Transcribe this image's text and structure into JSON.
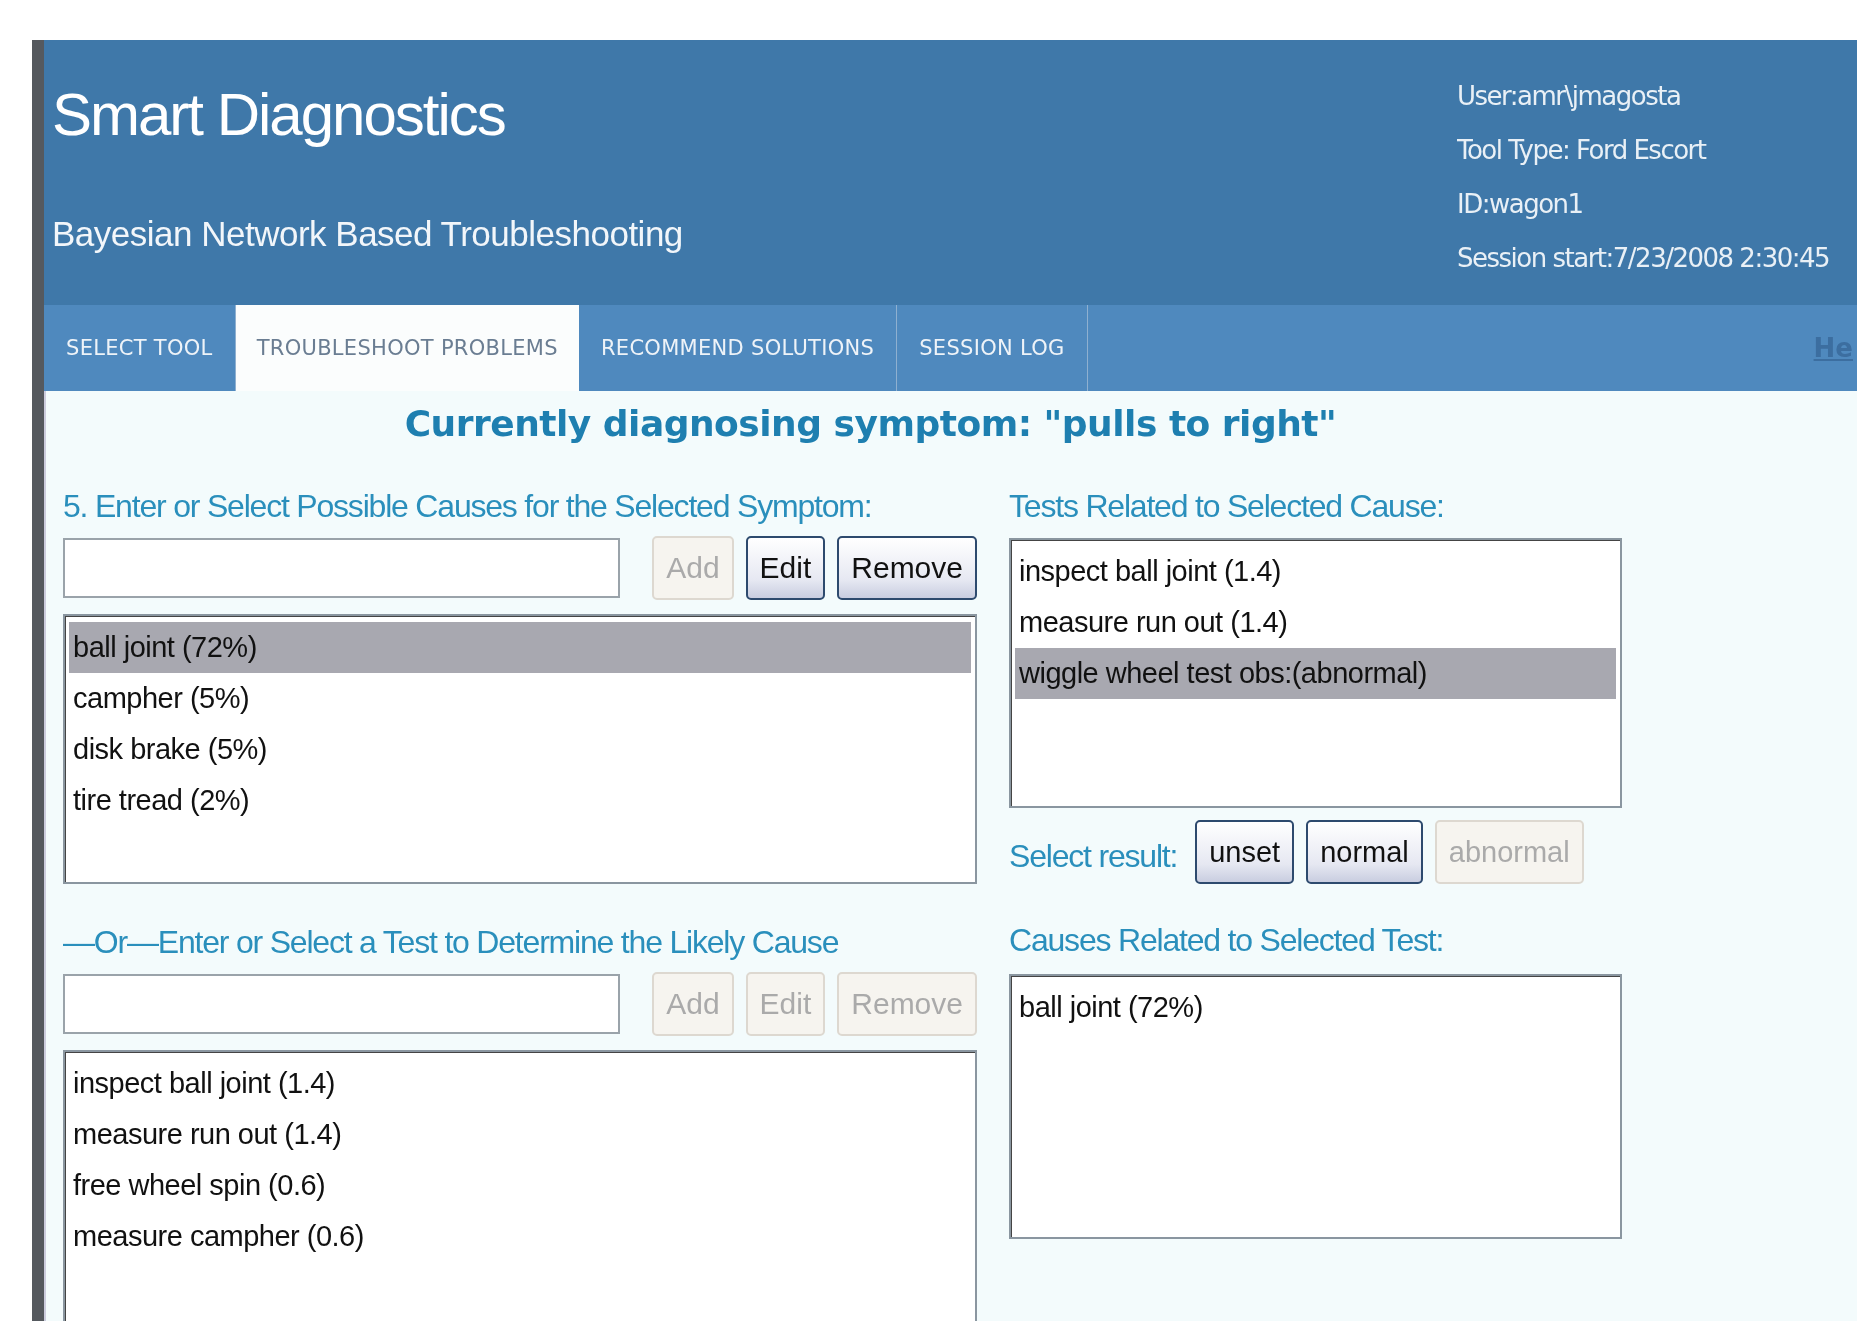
{
  "header": {
    "title": "Smart Diagnostics",
    "subtitle": "Bayesian Network Based Troubleshooting",
    "session_info": [
      "User:amr\\jmagosta",
      "Tool Type: Ford Escort",
      "ID:wagon1",
      "Session start:7/23/2008 2:30:45"
    ]
  },
  "tabs": [
    {
      "label": "SELECT TOOL",
      "selected": false
    },
    {
      "label": "TROUBLESHOOT PROBLEMS",
      "selected": true
    },
    {
      "label": "RECOMMEND SOLUTIONS",
      "selected": false
    },
    {
      "label": "SESSION LOG",
      "selected": false
    }
  ],
  "help_link": "He",
  "heading": "Currently diagnosing symptom: \"pulls to right\"",
  "causes_panel": {
    "label": "5. Enter or Select Possible Causes for the Selected Symptom:",
    "buttons": [
      {
        "label": "Add",
        "disabled": true
      },
      {
        "label": "Edit",
        "disabled": false
      },
      {
        "label": "Remove",
        "disabled": false
      }
    ],
    "items": [
      {
        "label": "ball joint (72%)",
        "selected": true
      },
      {
        "label": "campher (5%)",
        "selected": false
      },
      {
        "label": "disk brake (5%)",
        "selected": false
      },
      {
        "label": "tire tread (2%)",
        "selected": false
      }
    ]
  },
  "tests_panel": {
    "label": "—Or—Enter or Select a Test to Determine the Likely Cause",
    "buttons": [
      {
        "label": "Add",
        "disabled": true
      },
      {
        "label": "Edit",
        "disabled": true
      },
      {
        "label": "Remove",
        "disabled": true
      }
    ],
    "items": [
      {
        "label": "inspect ball joint (1.4)",
        "selected": false
      },
      {
        "label": "measure run out (1.4)",
        "selected": false
      },
      {
        "label": "free wheel spin (0.6)",
        "selected": false
      },
      {
        "label": "measure campher (0.6)",
        "selected": false
      }
    ]
  },
  "related_tests": {
    "label": "Tests Related to Selected Cause:",
    "items": [
      {
        "label": "inspect ball joint (1.4)",
        "selected": false
      },
      {
        "label": "measure run out (1.4)",
        "selected": false
      },
      {
        "label": "wiggle wheel test obs:(abnormal)",
        "selected": true
      }
    ]
  },
  "result_selector": {
    "label": "Select result:",
    "buttons": [
      {
        "label": "unset",
        "disabled": false
      },
      {
        "label": "normal",
        "disabled": false
      },
      {
        "label": "abnormal",
        "disabled": true
      }
    ]
  },
  "related_causes": {
    "label": "Causes Related to Selected Test:",
    "items": [
      {
        "label": "ball joint (72%)",
        "selected": false
      }
    ]
  }
}
